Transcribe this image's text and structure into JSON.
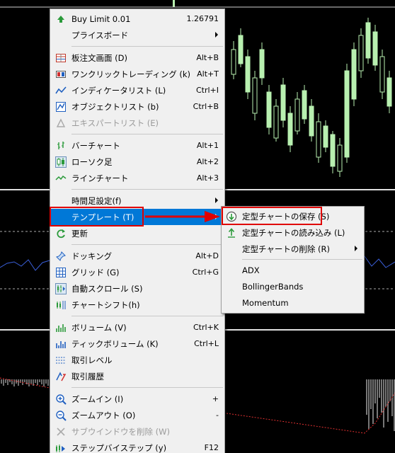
{
  "colors": {
    "menu_bg": "#f0f0f0",
    "highlight": "#0078d7",
    "annotation_red": "#e00000",
    "candle_up": "#b8f0b0",
    "chart_bg": "#000000"
  },
  "main_menu": {
    "items": [
      {
        "label": "Buy Limit 0.01",
        "shortcut": "1.26791",
        "icon": "buy-limit-icon"
      },
      {
        "label": "プライスボード",
        "icon": "none",
        "submenu": true
      },
      {
        "label": "板注文画面 (D)",
        "shortcut": "Alt+B",
        "icon": "order-book-icon"
      },
      {
        "label": "ワンクリックトレーディング (k)",
        "shortcut": "Alt+T",
        "icon": "one-click-icon"
      },
      {
        "label": "インディケータリスト (L)",
        "shortcut": "Ctrl+I",
        "icon": "indicator-list-icon"
      },
      {
        "label": "オブジェクトリスト (b)",
        "shortcut": "Ctrl+B",
        "icon": "object-list-icon"
      },
      {
        "label": "エキスパートリスト (E)",
        "icon": "expert-list-icon",
        "disabled": true
      },
      {
        "label": "バーチャート",
        "shortcut": "Alt+1",
        "icon": "bar-chart-icon"
      },
      {
        "label": "ローソク足",
        "shortcut": "Alt+2",
        "icon": "candlestick-icon"
      },
      {
        "label": "ラインチャート",
        "shortcut": "Alt+3",
        "icon": "line-chart-icon"
      },
      {
        "label": "時間足設定(f)",
        "submenu": true
      },
      {
        "label": "テンプレート (T)",
        "submenu": true,
        "highlighted": true
      },
      {
        "label": "更新",
        "icon": "refresh-icon"
      },
      {
        "label": "ドッキング",
        "shortcut": "Alt+D",
        "icon": "docking-icon"
      },
      {
        "label": "グリッド (G)",
        "shortcut": "Ctrl+G",
        "icon": "grid-icon"
      },
      {
        "label": "自動スクロール (S)",
        "icon": "auto-scroll-icon"
      },
      {
        "label": "チャートシフト(h)",
        "icon": "chart-shift-icon"
      },
      {
        "label": "ボリューム (V)",
        "shortcut": "Ctrl+K",
        "icon": "volume-icon"
      },
      {
        "label": "ティックボリューム (K)",
        "shortcut": "Ctrl+L",
        "icon": "tick-volume-icon"
      },
      {
        "label": "取引レベル",
        "icon": "trade-levels-icon"
      },
      {
        "label": "取引履歴",
        "icon": "trade-history-icon"
      },
      {
        "label": "ズームイン (I)",
        "shortcut": "+",
        "icon": "zoom-in-icon"
      },
      {
        "label": "ズームアウト (O)",
        "shortcut": "-",
        "icon": "zoom-out-icon"
      },
      {
        "label": "サブウインドウを削除 (W)",
        "icon": "delete-subwindow-icon",
        "disabled": true
      },
      {
        "label": "ステップバイステップ (y)",
        "shortcut": "F12",
        "icon": "step-by-step-icon"
      }
    ]
  },
  "template_submenu": {
    "items": [
      {
        "label": "定型チャートの保存 (S)",
        "icon": "save-template-icon"
      },
      {
        "label": "定型チャートの読み込み (L)",
        "icon": "load-template-icon"
      },
      {
        "label": "定型チャートの削除 (R)",
        "submenu": true
      },
      {
        "label": "ADX"
      },
      {
        "label": "BollingerBands"
      },
      {
        "label": "Momentum"
      }
    ]
  }
}
